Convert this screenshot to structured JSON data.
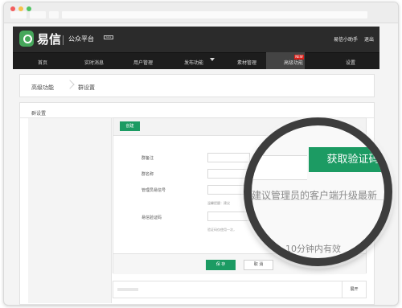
{
  "app": {
    "logo_text": "易信",
    "logo_subtitle": "公众平台",
    "beta_label": "beta"
  },
  "header": {
    "user_name": "易信小助手",
    "logout_label": "退出"
  },
  "nav": {
    "items": [
      {
        "label": "首页"
      },
      {
        "label": "实时消息"
      },
      {
        "label": "用户管理"
      },
      {
        "label": "发布功能"
      },
      {
        "label": "素材管理"
      },
      {
        "label": "高级功能"
      },
      {
        "label": "设置"
      }
    ],
    "new_badge": "NEW"
  },
  "breadcrumb": {
    "items": [
      "高级功能",
      "群设置"
    ]
  },
  "content": {
    "heading": "群设置",
    "tab_label": "创建"
  },
  "form": {
    "fields": [
      {
        "label": "群备注"
      },
      {
        "label": "群名称"
      },
      {
        "label": "管理员易信号"
      },
      {
        "label": "易信验证码"
      }
    ],
    "hints": [
      "温馨提醒：建议",
      "验证码仅使用一次，"
    ],
    "save_label": "保 存",
    "cancel_label": "取 消"
  },
  "footer": {
    "expand_label": "展开"
  },
  "magnifier": {
    "button_label": "获取验证码",
    "main_hint": "建议管理员的客户端升级最新",
    "sub_hint": "，10分钟内有效"
  },
  "colors": {
    "accent": "#1c9b63",
    "header_bg": "#2b2b2b",
    "nav_bg": "#1d1d1d",
    "badge_red": "#d91e18"
  }
}
